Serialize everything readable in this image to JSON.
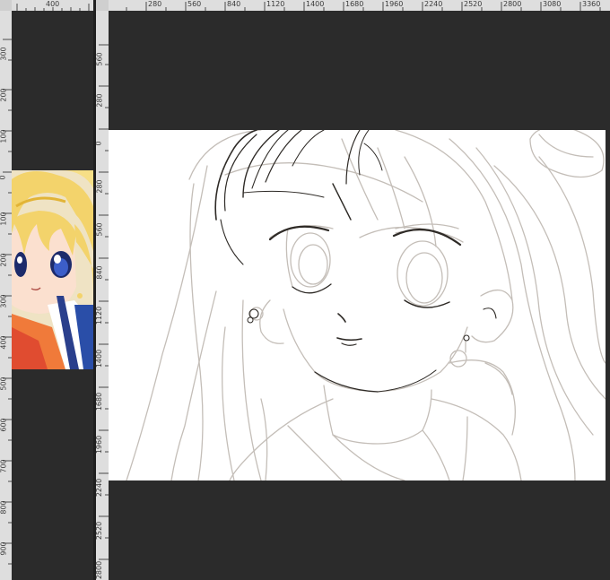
{
  "left_pane": {
    "top_ruler_labels": [
      "400"
    ],
    "side_ruler_labels": [
      "300",
      "200",
      "100",
      "0",
      "100",
      "200",
      "300",
      "400",
      "500",
      "600",
      "700",
      "800",
      "900"
    ],
    "reference_image": "reference-anime-portrait"
  },
  "right_pane": {
    "top_ruler_labels": [
      "280",
      "560",
      "840",
      "1120",
      "1400",
      "1680",
      "1960",
      "2240",
      "2520",
      "2800",
      "3080",
      "3360"
    ],
    "side_ruler_labels": [
      "560",
      "280",
      "0",
      "280",
      "560",
      "840",
      "1120",
      "1400",
      "1680",
      "1960",
      "2240",
      "2520",
      "2800"
    ],
    "canvas_content": "pencil-sketch-anime-girl"
  },
  "colors": {
    "workspace": "#2b2b2b",
    "ruler": "#dedede",
    "sketch_line": "#2e2a26",
    "sketch_rough": "#bdb7b0"
  }
}
